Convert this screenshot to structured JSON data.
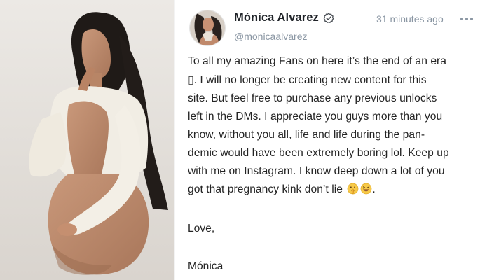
{
  "post": {
    "author": {
      "display_name": "Mónica Alvarez",
      "handle": "@monicaalvarez",
      "verified": true
    },
    "timestamp": "31 minutes ago",
    "message_lines": [
      "To all my amazing Fans on here it’s the end of an era",
      ". I will no longer be creating new content for this",
      "site. But feel free to purchase any previous unlocks",
      "left in the DMs. I appreciate you guys more than you",
      "know, without you all, life and life during the pan-",
      "demic would have been extremely boring lol. Keep up",
      "with me on Instagram. I know deep down a lot of you",
      "got that pregnancy kink don’t lie"
    ],
    "missing_glyph": "▯",
    "trailing_punctuation": ".",
    "emojis": [
      "shushing-face-emoji",
      "grinning-squinting-face-emoji"
    ],
    "signoff": "Love,",
    "signature": "Mónica"
  },
  "icons": {
    "verified": "verified-check-icon",
    "more": "more-dots-icon"
  },
  "colors": {
    "name": "#1f2328",
    "meta": "#8a96a3",
    "body_text": "#242424",
    "background": "#ffffff"
  }
}
